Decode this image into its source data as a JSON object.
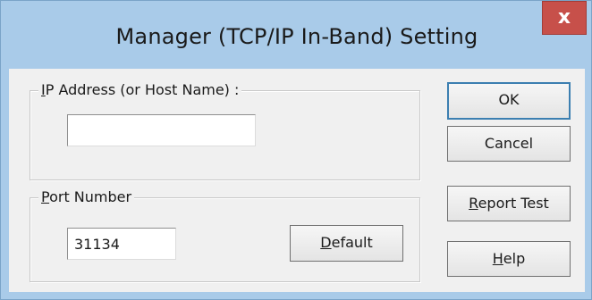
{
  "window": {
    "title": "Manager (TCP/IP In-Band) Setting",
    "close_glyph": "x",
    "colors": {
      "titlebar": "#a9cbe9",
      "close_button": "#c7504a",
      "client": "#f0f0f0"
    }
  },
  "ip_group": {
    "legend_accel": "I",
    "legend_rest": "P Address (or Host Name) :",
    "ip_value": ""
  },
  "port_group": {
    "legend_accel": "P",
    "legend_rest": "ort Number",
    "port_value": "31134",
    "default_button": {
      "accel": "D",
      "rest": "efault"
    }
  },
  "buttons": {
    "ok": "OK",
    "cancel": "Cancel",
    "report_test": {
      "accel": "R",
      "rest": "eport Test"
    },
    "help": {
      "accel": "H",
      "rest": "elp"
    }
  },
  "icons": {
    "close": "close-icon"
  }
}
